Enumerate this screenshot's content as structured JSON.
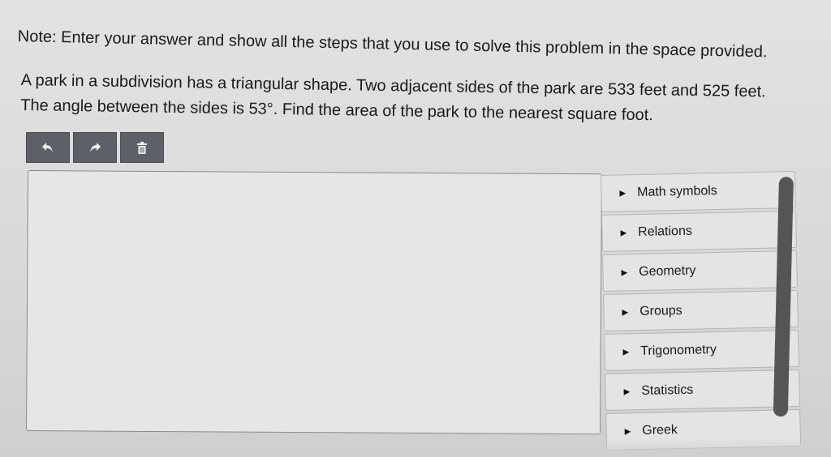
{
  "note": "Note: Enter your answer and show all the steps that you use to solve this problem in the space provided.",
  "problem": {
    "line1": "A park in a subdivision has a triangular shape. Two adjacent sides of the park are 533 feet and 525 feet.",
    "line2": "The angle between the sides is 53°. Find the area of the park to the nearest square foot."
  },
  "toolbar": {
    "buttons": [
      {
        "icon": "undo-icon"
      },
      {
        "icon": "redo-icon"
      },
      {
        "icon": "trash-icon"
      }
    ]
  },
  "editor": {
    "value": ""
  },
  "palette": {
    "items": [
      {
        "label": "Math symbols"
      },
      {
        "label": "Relations"
      },
      {
        "label": "Geometry"
      },
      {
        "label": "Groups"
      },
      {
        "label": "Trigonometry"
      },
      {
        "label": "Statistics"
      },
      {
        "label": "Greek"
      }
    ]
  },
  "colors": {
    "toolbar_button": "#5d6066",
    "scrollbar": "#555555"
  }
}
